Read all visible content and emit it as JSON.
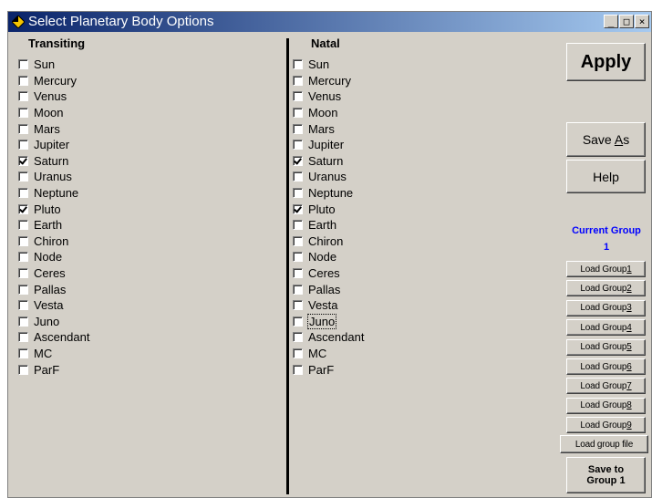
{
  "window": {
    "title": "Select Planetary Body Options"
  },
  "titlebar_buttons": {
    "minimize": "_",
    "maximize": "□",
    "close": "×"
  },
  "transiting": {
    "header": "Transiting",
    "items": [
      {
        "label": "Sun",
        "checked": false
      },
      {
        "label": "Mercury",
        "checked": false
      },
      {
        "label": "Venus",
        "checked": false
      },
      {
        "label": "Moon",
        "checked": false
      },
      {
        "label": "Mars",
        "checked": false
      },
      {
        "label": "Jupiter",
        "checked": false
      },
      {
        "label": "Saturn",
        "checked": true
      },
      {
        "label": "Uranus",
        "checked": false
      },
      {
        "label": "Neptune",
        "checked": false
      },
      {
        "label": "Pluto",
        "checked": true
      },
      {
        "label": "Earth",
        "checked": false
      },
      {
        "label": "Chiron",
        "checked": false
      },
      {
        "label": "Node",
        "checked": false
      },
      {
        "label": "Ceres",
        "checked": false
      },
      {
        "label": "Pallas",
        "checked": false
      },
      {
        "label": "Vesta",
        "checked": false
      },
      {
        "label": "Juno",
        "checked": false
      },
      {
        "label": "Ascendant",
        "checked": false
      },
      {
        "label": "MC",
        "checked": false
      },
      {
        "label": "ParF",
        "checked": false
      }
    ]
  },
  "natal": {
    "header": "Natal",
    "items": [
      {
        "label": "Sun",
        "checked": false
      },
      {
        "label": "Mercury",
        "checked": false
      },
      {
        "label": "Venus",
        "checked": false
      },
      {
        "label": "Moon",
        "checked": false
      },
      {
        "label": "Mars",
        "checked": false
      },
      {
        "label": "Jupiter",
        "checked": false
      },
      {
        "label": "Saturn",
        "checked": true
      },
      {
        "label": "Uranus",
        "checked": false
      },
      {
        "label": "Neptune",
        "checked": false
      },
      {
        "label": "Pluto",
        "checked": true
      },
      {
        "label": "Earth",
        "checked": false
      },
      {
        "label": "Chiron",
        "checked": false
      },
      {
        "label": "Node",
        "checked": false
      },
      {
        "label": "Ceres",
        "checked": false
      },
      {
        "label": "Pallas",
        "checked": false
      },
      {
        "label": "Vesta",
        "checked": false
      },
      {
        "label": "Juno",
        "checked": false,
        "focused": true
      },
      {
        "label": "Ascendant",
        "checked": false
      },
      {
        "label": "MC",
        "checked": false
      },
      {
        "label": "ParF",
        "checked": false
      }
    ]
  },
  "buttons": {
    "apply": "Apply",
    "save_as_prefix": "Save ",
    "save_as_mnemonic": "A",
    "save_as_suffix": "s",
    "help": "Help",
    "load_group_prefix": "Load Group ",
    "load_groups": [
      "1",
      "2",
      "3",
      "4",
      "5",
      "6",
      "7",
      "8",
      "9"
    ],
    "load_group_file": "Load group file",
    "save_to_group_line1": "Save to",
    "save_to_group_line2": "Group 1"
  },
  "current_group": {
    "label": "Current Group",
    "value": "1"
  },
  "colors": {
    "title_start": "#0a246a",
    "title_end": "#a6caf0",
    "current_group": "#0000ff",
    "face": "#d4d0c8"
  },
  "icons": {
    "title": "diamond-icon"
  }
}
